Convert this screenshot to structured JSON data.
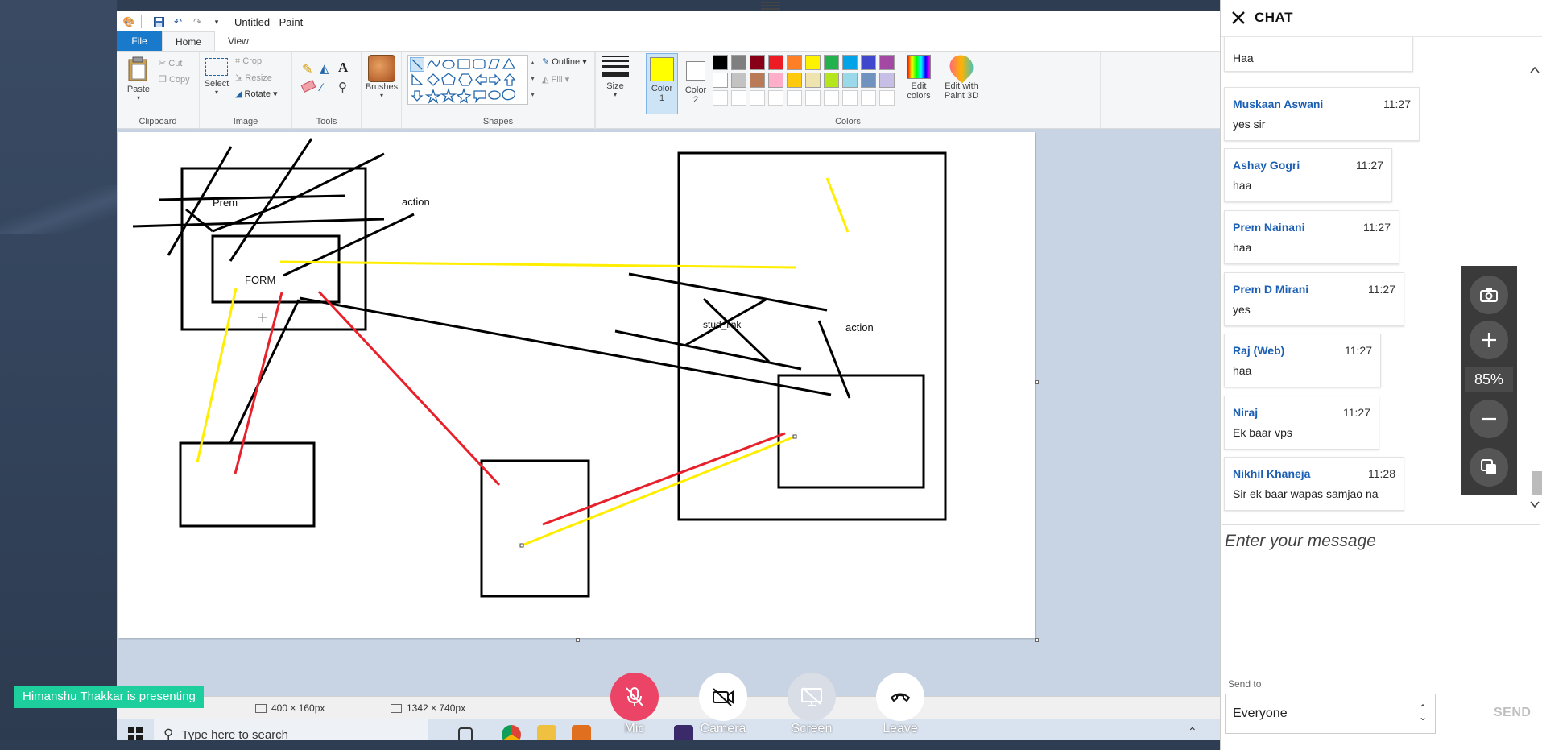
{
  "paint": {
    "window_title": "Untitled - Paint",
    "tabs": {
      "file": "File",
      "home": "Home",
      "view": "View"
    },
    "clipboard": {
      "paste": "Paste",
      "cut": "Cut",
      "copy": "Copy",
      "label": "Clipboard"
    },
    "image": {
      "select": "Select",
      "crop": "Crop",
      "resize": "Resize",
      "rotate": "Rotate",
      "label": "Image"
    },
    "tools": {
      "label": "Tools"
    },
    "brushes": "Brushes",
    "shapes": {
      "outline": "Outline",
      "fill": "Fill",
      "label": "Shapes"
    },
    "size": "Size",
    "color1": {
      "line1": "Color",
      "line2": "1",
      "value": "#ffff00"
    },
    "color2": {
      "line1": "Color",
      "line2": "2",
      "value": "#ffffff"
    },
    "palette_row1": [
      "#000000",
      "#7f7f7f",
      "#880015",
      "#ed1c24",
      "#ff7f27",
      "#fff200",
      "#22b14c",
      "#00a2e8",
      "#3f48cc",
      "#a349a4"
    ],
    "palette_row2": [
      "#ffffff",
      "#c3c3c3",
      "#b97a57",
      "#ffaec9",
      "#ffc90e",
      "#efe4b0",
      "#b5e61d",
      "#99d9ea",
      "#7092be",
      "#c8bfe7"
    ],
    "edit_colors": {
      "line1": "Edit",
      "line2": "colors"
    },
    "paint3d": {
      "line1": "Edit with",
      "line2": "Paint 3D"
    },
    "colors_label": "Colors",
    "canvas_labels": {
      "prem": "Prem",
      "action1": "action",
      "form": "FORM",
      "studlink": "stud_link",
      "action2": "action"
    },
    "status": {
      "selection": "400 × 160px",
      "canvas_size": "1342 × 740px"
    },
    "taskbar": {
      "search_placeholder": "Type here to search"
    }
  },
  "presenter_badge": "Himanshu Thakkar is presenting",
  "controls": {
    "mic": "Mic",
    "camera": "Camera",
    "screen": "Screen",
    "leave": "Leave"
  },
  "chat": {
    "title": "CHAT",
    "messages": [
      {
        "name": "",
        "time": "",
        "text": "Haa"
      },
      {
        "name": "Muskaan Aswani",
        "time": "11:27",
        "text": "yes sir"
      },
      {
        "name": "Ashay Gogri",
        "time": "11:27",
        "text": "haa"
      },
      {
        "name": "Prem Nainani",
        "time": "11:27",
        "text": "haa"
      },
      {
        "name": "Prem D Mirani",
        "time": "11:27",
        "text": "yes"
      },
      {
        "name": "Raj (Web)",
        "time": "11:27",
        "text": "haa"
      },
      {
        "name": "Niraj",
        "time": "11:27",
        "text": "Ek baar vps"
      },
      {
        "name": "Nikhil Khaneja",
        "time": "11:28",
        "text": "Sir ek baar wapas samjao na"
      }
    ],
    "input_placeholder": "Enter your message",
    "send_to_label": "Send to",
    "send_to_value": "Everyone",
    "send_button": "SEND"
  },
  "zoom": {
    "level": "85%"
  }
}
